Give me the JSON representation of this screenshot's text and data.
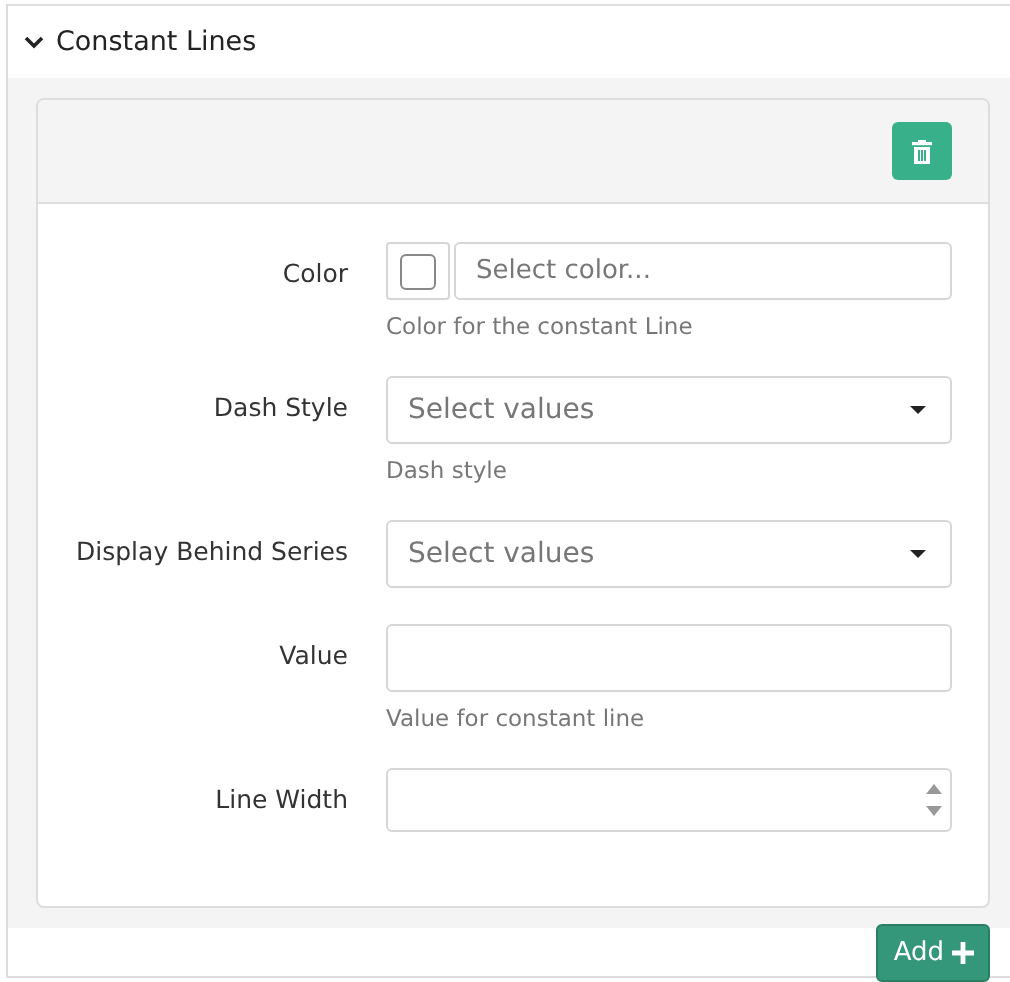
{
  "section": {
    "title": "Constant Lines",
    "expanded": true
  },
  "fields": [
    {
      "kind": "color",
      "label": "Color",
      "placeholder": "Select color...",
      "help": "Color for the constant Line"
    },
    {
      "kind": "select",
      "label": "Dash Style",
      "placeholder": "Select values",
      "help": "Dash style"
    },
    {
      "kind": "select",
      "label": "Display Behind Series",
      "placeholder": "Select values"
    },
    {
      "kind": "text",
      "label": "Value",
      "help": "Value for constant line"
    },
    {
      "kind": "number",
      "label": "Line Width"
    }
  ],
  "add_button": {
    "label": "Add"
  }
}
